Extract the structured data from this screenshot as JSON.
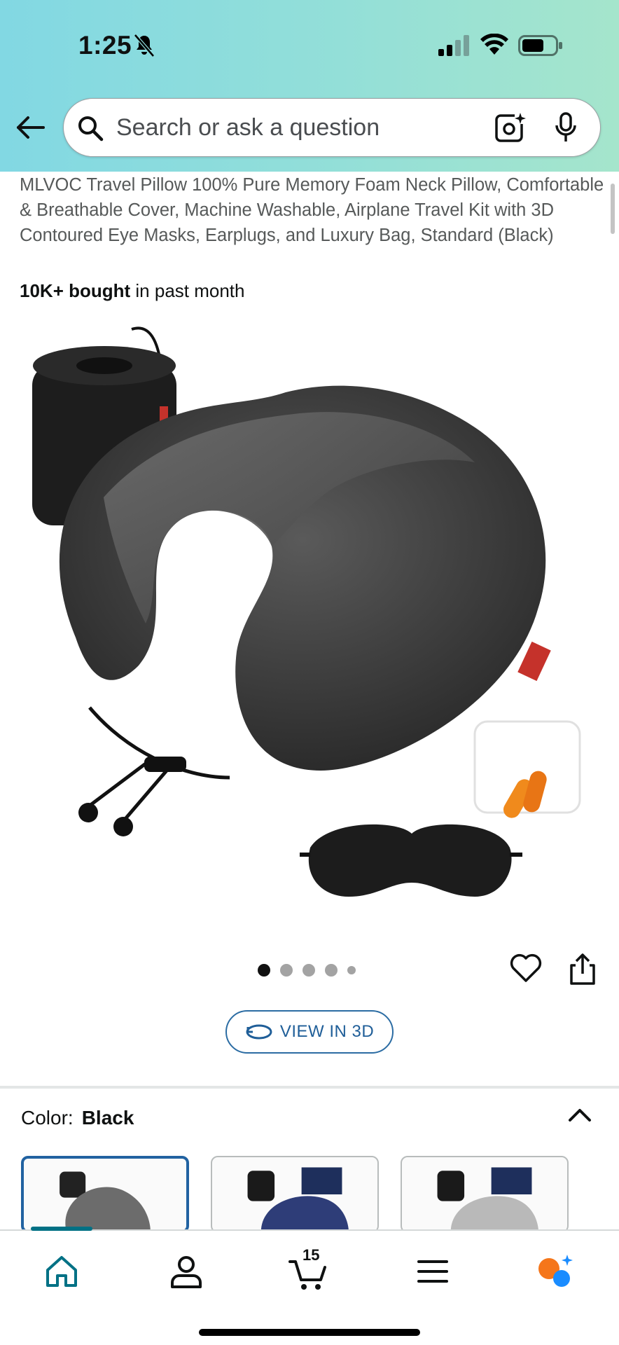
{
  "status_bar": {
    "time": "1:25",
    "icons": [
      "bell-slash-icon",
      "cellular-signal-icon",
      "wifi-icon",
      "battery-icon"
    ]
  },
  "search": {
    "placeholder": "Search or ask a question",
    "icons": [
      "back-arrow-icon",
      "search-icon",
      "camera-lens-icon",
      "microphone-icon"
    ]
  },
  "product": {
    "title": "MLVOC Travel Pillow 100% Pure Memory Foam Neck Pillow, Comfortable & Breathable Cover, Machine Washable, Airplane Travel Kit with 3D Contoured Eye Masks, Earplugs, and Luxury Bag, Standard (Black)",
    "bought_bold": "10K+ bought",
    "bought_rest": " in past month"
  },
  "gallery": {
    "image_count": 5,
    "active_index": 0,
    "view_3d_label": "VIEW IN 3D"
  },
  "color": {
    "label": "Color:",
    "value": "Black",
    "swatches": [
      "Black",
      "Navy",
      "Grey"
    ]
  },
  "bottom_nav": {
    "items": [
      "home-icon",
      "account-icon",
      "cart-icon",
      "menu-icon",
      "rufus-icon"
    ],
    "cart_count": "15"
  },
  "colors": {
    "accent_teal": "#007185",
    "link_blue": "#2162a1",
    "header_gradient_start": "#82d8e3",
    "header_gradient_end": "#a5e5cc",
    "rufus_orange": "#f5761a",
    "rufus_blue": "#1a8cff"
  }
}
